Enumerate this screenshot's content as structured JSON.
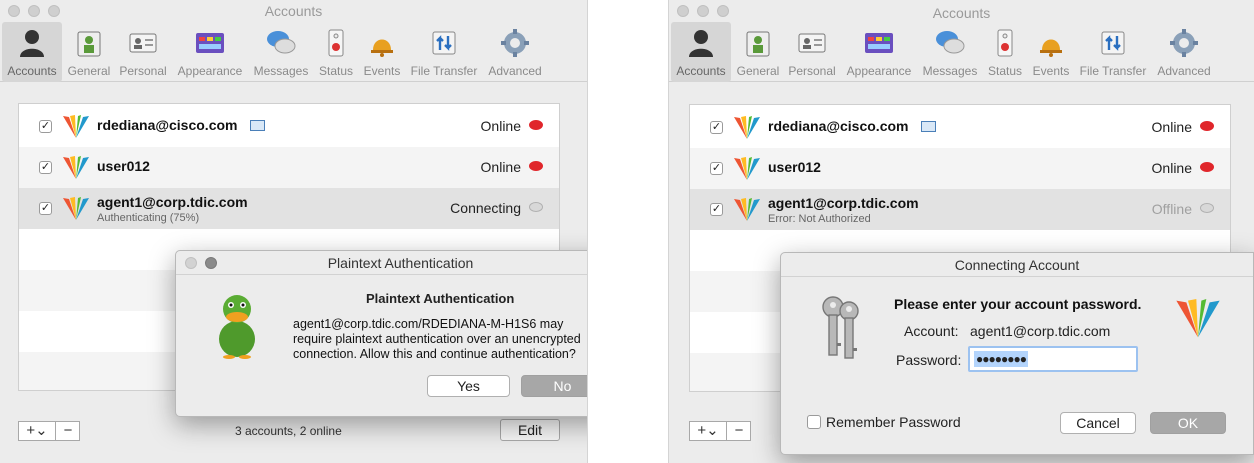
{
  "left_window": {
    "title": "Accounts",
    "toolbar": [
      {
        "label": "Accounts",
        "icon": "accounts-icon"
      },
      {
        "label": "General",
        "icon": "general-icon"
      },
      {
        "label": "Personal",
        "icon": "personal-icon"
      },
      {
        "label": "Appearance",
        "icon": "appearance-icon"
      },
      {
        "label": "Messages",
        "icon": "messages-icon"
      },
      {
        "label": "Status",
        "icon": "status-icon"
      },
      {
        "label": "Events",
        "icon": "events-icon"
      },
      {
        "label": "File Transfer",
        "icon": "file-transfer-icon"
      },
      {
        "label": "Advanced",
        "icon": "advanced-icon"
      }
    ],
    "accounts": [
      {
        "name": "rdediana@cisco.com",
        "sub": "",
        "status": "Online",
        "checked": "✓"
      },
      {
        "name": "user012",
        "sub": "",
        "status": "Online",
        "checked": "✓"
      },
      {
        "name": "agent1@corp.tdic.com",
        "sub": "Authenticating (75%)",
        "status": "Connecting",
        "checked": "✓"
      }
    ],
    "add_button": "+⌄",
    "remove_button": "−",
    "summary": "3 accounts, 2 online",
    "edit_button": "Edit"
  },
  "plaintext_dialog": {
    "window_title": "Plaintext Authentication",
    "heading": "Plaintext Authentication",
    "message_line1": "agent1@corp.tdic.com/RDEDIANA-M-H1S6 may",
    "message_line2": "require plaintext authentication over an unencrypted",
    "message_line3": "connection.  Allow this and continue authentication?",
    "yes_button": "Yes",
    "no_button": "No"
  },
  "right_window": {
    "title": "Accounts",
    "toolbar": [
      {
        "label": "Accounts",
        "icon": "accounts-icon"
      },
      {
        "label": "General",
        "icon": "general-icon"
      },
      {
        "label": "Personal",
        "icon": "personal-icon"
      },
      {
        "label": "Appearance",
        "icon": "appearance-icon"
      },
      {
        "label": "Messages",
        "icon": "messages-icon"
      },
      {
        "label": "Status",
        "icon": "status-icon"
      },
      {
        "label": "Events",
        "icon": "events-icon"
      },
      {
        "label": "File Transfer",
        "icon": "file-transfer-icon"
      },
      {
        "label": "Advanced",
        "icon": "advanced-icon"
      }
    ],
    "accounts": [
      {
        "name": "rdediana@cisco.com",
        "sub": "",
        "status": "Online",
        "checked": "✓"
      },
      {
        "name": "user012",
        "sub": "",
        "status": "Online",
        "checked": "✓"
      },
      {
        "name": "agent1@corp.tdic.com",
        "sub": "Error: Not Authorized",
        "status": "Offline",
        "checked": "✓"
      }
    ],
    "add_button": "+⌄",
    "remove_button": "−"
  },
  "password_dialog": {
    "window_title": "Connecting Account",
    "heading": "Please enter your account password.",
    "account_label": "Account:",
    "account_value": "agent1@corp.tdic.com",
    "password_label": "Password:",
    "password_value": "●●●●●●●●",
    "remember_label": "Remember Password",
    "cancel_button": "Cancel",
    "ok_button": "OK"
  },
  "colors": {
    "online_bubble": "#e0262b",
    "offline_bubble": "#c4c4c4",
    "selection_highlight": "#b3d4fc"
  }
}
